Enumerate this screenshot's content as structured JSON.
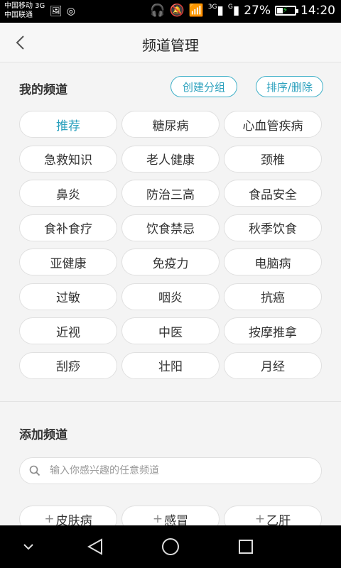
{
  "status_bar": {
    "carrier1": "中国移动 3G",
    "carrier2": "中国联通",
    "network_3g": "3G",
    "network_g": "G",
    "battery": "27%",
    "time": "14:20"
  },
  "header": {
    "title": "频道管理"
  },
  "my_channels": {
    "title": "我的频道",
    "create_group": "创建分组",
    "sort_delete": "排序/删除",
    "items": [
      "推荐",
      "糖尿病",
      "心血管疾病",
      "急救知识",
      "老人健康",
      "颈椎",
      "鼻炎",
      "防治三高",
      "食品安全",
      "食补食疗",
      "饮食禁忌",
      "秋季饮食",
      "亚健康",
      "免疫力",
      "电脑病",
      "过敏",
      "咽炎",
      "抗癌",
      "近视",
      "中医",
      "按摩推拿",
      "刮痧",
      "壮阳",
      "月经"
    ],
    "active_index": 0,
    "accent_color": "#2aa0bd"
  },
  "add_channels": {
    "title": "添加频道",
    "search_placeholder": "输入你感兴趣的任意频道",
    "items": [
      "皮肤病",
      "感冒",
      "乙肝"
    ]
  },
  "icons": {
    "back": "back-chevron-icon",
    "search": "search-icon",
    "nav": [
      "nav-down-icon",
      "nav-back-icon",
      "nav-home-icon",
      "nav-recents-icon"
    ]
  }
}
